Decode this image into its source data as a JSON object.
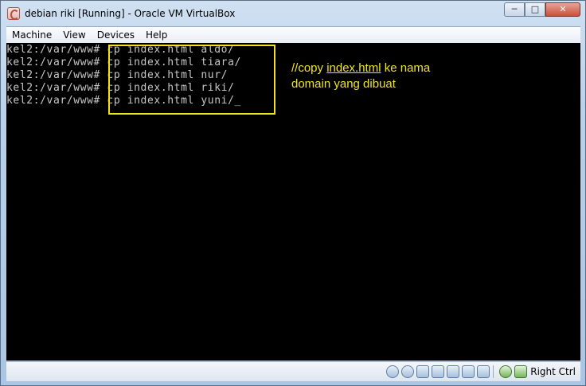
{
  "window": {
    "title": "debian riki [Running] - Oracle VM VirtualBox",
    "buttons": {
      "minimize": "─",
      "maximize": "□",
      "close": "✕"
    }
  },
  "menu": [
    "Machine",
    "View",
    "Devices",
    "Help"
  ],
  "terminal": {
    "lines": [
      {
        "prompt": "kel2:/var/www#",
        "command": " cp index.html aldo/"
      },
      {
        "prompt": "kel2:/var/www#",
        "command": " cp index.html tiara/"
      },
      {
        "prompt": "kel2:/var/www#",
        "command": " cp index.html nur/"
      },
      {
        "prompt": "kel2:/var/www#",
        "command": " cp index.html riki/"
      },
      {
        "prompt": "kel2:/var/www#",
        "command": " cp index.html yuni/"
      }
    ],
    "cursor": "_"
  },
  "annotation": {
    "line1_prefix": "//copy ",
    "line1_link": "index.html",
    "line1_suffix": " ke nama",
    "line2": "domain yang dibuat",
    "color": "#f2e51c"
  },
  "statusbar": {
    "icons": [
      "hard-disk-icon",
      "optical-disk-icon",
      "usb-icon",
      "shared-folders-icon",
      "display-icon",
      "storage-icon",
      "chip-icon",
      "mouse-integration-icon",
      "host-key-icon"
    ],
    "host_key": "Right Ctrl"
  }
}
